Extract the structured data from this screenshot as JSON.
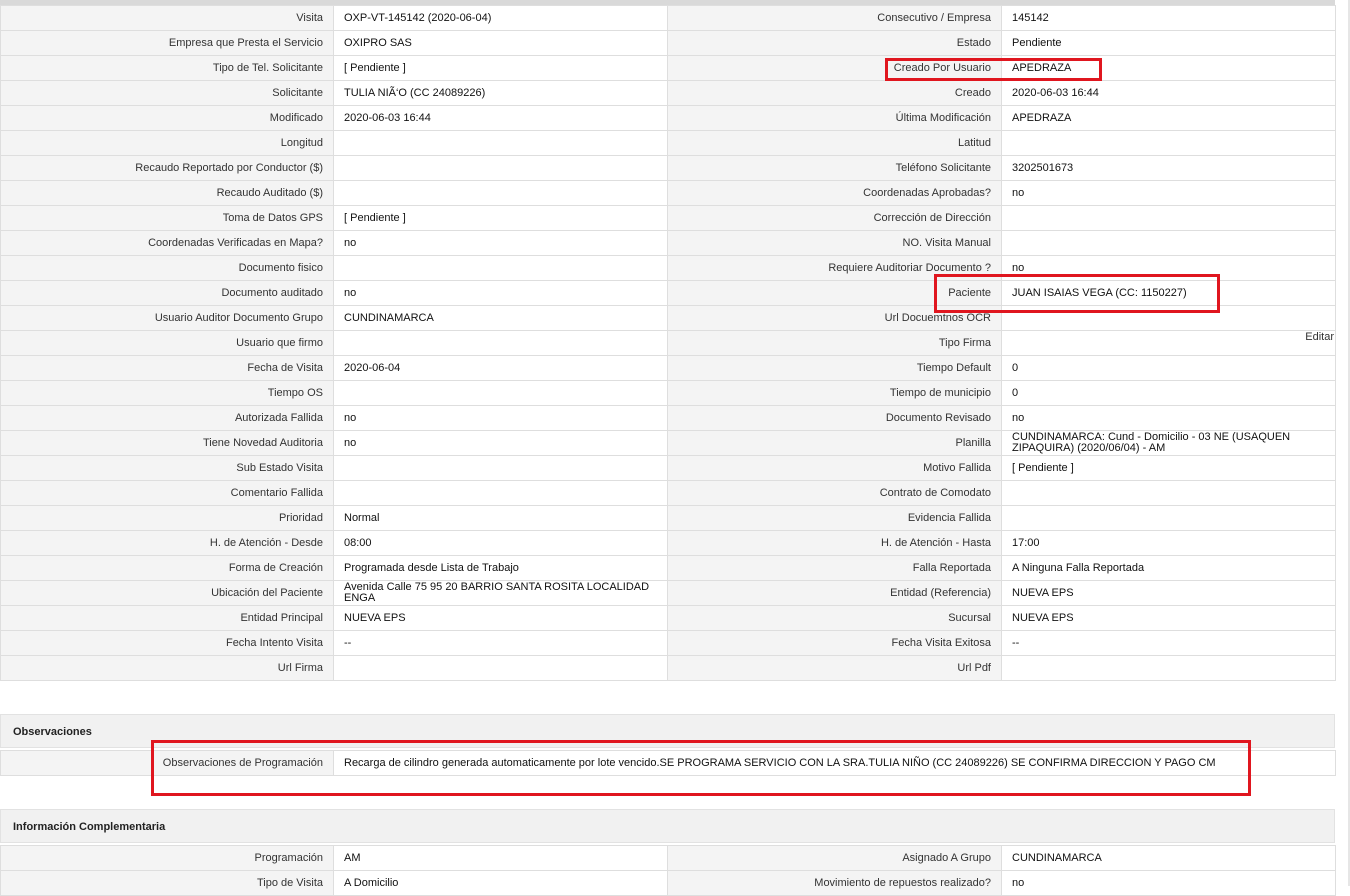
{
  "main_rows": [
    {
      "l1": "Visita",
      "v1": "OXP-VT-145142 (2020-06-04)",
      "l2": "Consecutivo / Empresa",
      "v2": "145142"
    },
    {
      "l1": "Empresa que Presta el Servicio",
      "v1": "OXIPRO SAS",
      "l2": "Estado",
      "v2": "Pendiente"
    },
    {
      "l1": "Tipo de Tel. Solicitante",
      "v1": "[ Pendiente ]",
      "l2": "Creado Por Usuario",
      "v2": "APEDRAZA"
    },
    {
      "l1": "Solicitante",
      "v1": "TULIA NIÃ‘O (CC 24089226)",
      "l2": "Creado",
      "v2": "2020-06-03 16:44"
    },
    {
      "l1": "Modificado",
      "v1": "2020-06-03 16:44",
      "l2": "Última Modificación",
      "v2": " APEDRAZA"
    },
    {
      "l1": "Longitud",
      "v1": "",
      "l2": "Latitud",
      "v2": ""
    },
    {
      "l1": "Recaudo Reportado por Conductor ($)",
      "v1": "",
      "l2": "Teléfono Solicitante",
      "v2": "3202501673"
    },
    {
      "l1": "Recaudo Auditado ($)",
      "v1": "",
      "l2": "Coordenadas Aprobadas?",
      "v2": " no"
    },
    {
      "l1": "Toma de Datos GPS",
      "v1": "[ Pendiente ]",
      "l2": "Corrección de Dirección",
      "v2": ""
    },
    {
      "l1": "Coordenadas Verificadas en Mapa?",
      "v1": " no",
      "l2": "NO. Visita Manual",
      "v2": ""
    },
    {
      "l1": "Documento fisico",
      "v1": "",
      "l2": "Requiere Auditoriar Documento ?",
      "v2": " no"
    },
    {
      "l1": "Documento auditado",
      "v1": " no",
      "l2": "Paciente",
      "v2": "JUAN ISAIAS VEGA (CC: 1150227)"
    },
    {
      "l1": "Usuario Auditor Documento Grupo",
      "v1": "CUNDINAMARCA",
      "l2": "Url Docuemtnos OCR",
      "v2": ""
    },
    {
      "l1": "Usuario que firmo",
      "v1": "",
      "l2": "Tipo Firma",
      "v2": ""
    },
    {
      "l1": "Fecha de Visita",
      "v1": " 2020-06-04",
      "l2": "Tiempo Default",
      "v2": "0"
    },
    {
      "l1": "Tiempo OS",
      "v1": "",
      "l2": "Tiempo de municipio",
      "v2": "0"
    },
    {
      "l1": "Autorizada Fallida",
      "v1": " no",
      "l2": "Documento Revisado",
      "v2": " no"
    },
    {
      "l1": "Tiene Novedad Auditoria",
      "v1": " no",
      "l2": "Planilla",
      "v2": "CUNDINAMARCA: Cund - Domicilio - 03 NE (USAQUEN ZIPAQUIRA) (2020/06/04) - AM"
    },
    {
      "l1": "Sub Estado Visita",
      "v1": "",
      "l2": "Motivo Fallida",
      "v2": "[ Pendiente ]"
    },
    {
      "l1": "Comentario Fallida",
      "v1": "",
      "l2": "Contrato de Comodato",
      "v2": ""
    },
    {
      "l1": "Prioridad",
      "v1": "Normal",
      "l2": "Evidencia Fallida",
      "v2": ""
    },
    {
      "l1": "H. de Atención - Desde",
      "v1": "08:00",
      "l2": "H. de Atención - Hasta",
      "v2": "17:00"
    },
    {
      "l1": "Forma de Creación",
      "v1": "Programada desde Lista de Trabajo",
      "l2": "Falla Reportada",
      "v2": "A Ninguna Falla Reportada"
    },
    {
      "l1": "Ubicación del Paciente",
      "v1": "Avenida Calle 75 95 20 BARRIO SANTA ROSITA LOCALIDAD ENGA",
      "l2": "Entidad (Referencia)",
      "v2": "NUEVA EPS"
    },
    {
      "l1": "Entidad Principal",
      "v1": "NUEVA EPS",
      "l2": "Sucursal",
      "v2": "NUEVA EPS"
    },
    {
      "l1": "Fecha Intento Visita",
      "v1": " --",
      "l2": "Fecha Visita Exitosa",
      "v2": " --"
    },
    {
      "l1": "Url Firma",
      "v1": "",
      "l2": "Url Pdf",
      "v2": ""
    }
  ],
  "edit_label": "Editar",
  "observaciones": {
    "title": "Observaciones",
    "label": "Observaciones de Programación",
    "value": " Recarga de cilindro generada automaticamente por lote vencido.SE PROGRAMA SERVICIO CON LA SRA.TULIA NIÑO (CC 24089226) SE CONFIRMA DIRECCION Y PAGO CM"
  },
  "complementaria": {
    "title": "Información Complementaria",
    "rows": [
      {
        "l1": "Programación",
        "v1": "AM",
        "l2": "Asignado A Grupo",
        "v2": "CUNDINAMARCA"
      },
      {
        "l1": "Tipo de Visita",
        "v1": "A Domicilio",
        "l2": "Movimiento de repuestos realizado?",
        "v2": " no"
      }
    ]
  },
  "highlight_color": "#e0161f"
}
